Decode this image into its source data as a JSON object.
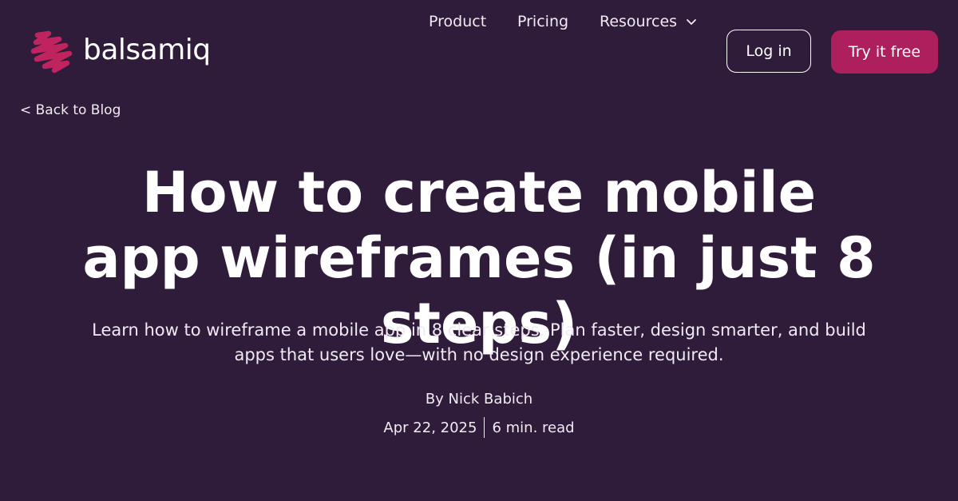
{
  "brand": {
    "name": "balsamiq",
    "logo_icon": "balsamiq-scribble-logo",
    "accent_color": "#ad1f5d",
    "background_color": "#2f1c3a"
  },
  "nav": {
    "product": "Product",
    "pricing": "Pricing",
    "resources": "Resources",
    "login": "Log in",
    "try_free": "Try it free"
  },
  "back_link": "< Back to Blog",
  "article": {
    "title": "How to create mobile app wireframes (in just 8 steps)",
    "subtitle": "Learn how to wireframe a mobile app in 8 clear steps. Plan faster, design smarter, and build apps that users love—with no design experience required.",
    "author": "By Nick Babich",
    "date": "Apr 22, 2025",
    "read_time": "6 min. read"
  }
}
